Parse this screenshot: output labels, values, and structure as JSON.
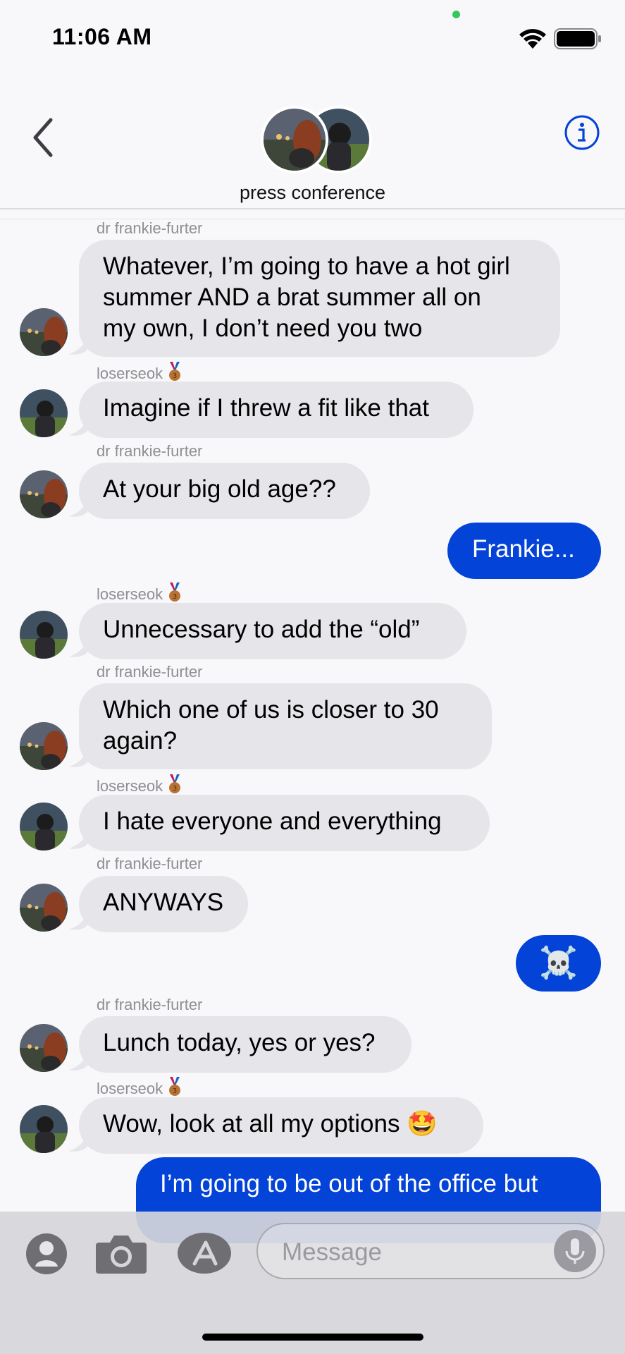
{
  "status_bar": {
    "time": "11:06 AM"
  },
  "nav": {
    "group_name": "press conference",
    "back_icon": "chevron-left-icon",
    "info_icon": "info-icon"
  },
  "messages": [
    {
      "sender": "dr frankie-furter",
      "text_lines": [
        "Whatever, I’m going to have a hot girl",
        "summer AND a brat summer all on",
        "my own, I don’t need you two"
      ]
    },
    {
      "sender": "loserseok",
      "text": "Imagine if I threw a fit like that"
    },
    {
      "sender": "dr frankie-furter",
      "text": "At your big old age??"
    },
    {
      "outgoing": true,
      "text": "Frankie..."
    },
    {
      "sender": "loserseok",
      "text": "Unnecessary to add the “old”"
    },
    {
      "sender": "dr frankie-furter",
      "text_lines": [
        "Which one of us is closer to 30",
        "again?"
      ]
    },
    {
      "sender": "loserseok",
      "text": "I hate everyone and everything"
    },
    {
      "sender": "dr frankie-furter",
      "text": "ANYWAYS"
    },
    {
      "outgoing": true,
      "text": "☠️"
    },
    {
      "sender": "dr frankie-furter",
      "text": "Lunch today, yes or yes?"
    },
    {
      "sender": "loserseok",
      "text": "Wow, look at all my options 🤩"
    },
    {
      "outgoing": true,
      "text": "I’m going to be out of the office but"
    }
  ],
  "input_bar": {
    "placeholder": "Message"
  },
  "colors": {
    "outgoing_bubble": "#0343D7",
    "incoming_bubble": "#E5E5EA",
    "sender_name": "#8E8E93",
    "accent": "#0343D7"
  }
}
